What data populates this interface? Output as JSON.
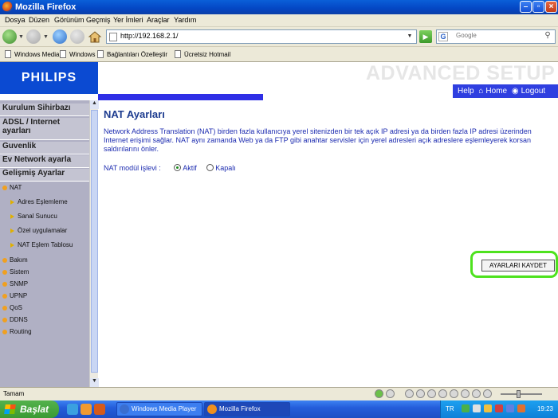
{
  "window": {
    "title": "Mozilla Firefox"
  },
  "menu": [
    "Dosya",
    "Düzen",
    "Görünüm",
    "Geçmiş",
    "Yer İmleri",
    "Araçlar",
    "Yardım"
  ],
  "navbar": {
    "url": "http://192.168.2.1/",
    "search_placeholder": "Google"
  },
  "bookmarks": [
    "Windows Media",
    "Windows",
    "Bağlantıları Özelleştir",
    "Ücretsiz Hotmail"
  ],
  "page": {
    "logo": "PHILIPS",
    "banner": "ADVANCED SETUP",
    "help_links": [
      "Help",
      "Home",
      "Logout"
    ],
    "sidebar": {
      "sections": [
        "Kurulum Sihirbazı",
        "ADSL / Internet ayarları",
        "Guvenlik",
        "Ev Network ayarla",
        "Gelişmiş Ayarlar"
      ],
      "items": [
        "NAT",
        "Adres Eşlemleme",
        "Sanal Sunucu",
        "Özel uygulamalar",
        "NAT Eşlem Tablosu",
        "Bakım",
        "Sistem",
        "SNMP",
        "UPNP",
        "QoS",
        "DDNS",
        "Routing"
      ]
    },
    "heading": "NAT Ayarları",
    "description": "Network Address Translation (NAT) birden fazla kullanıcıya yerel sitenizden bir tek açık IP adresi ya da birden fazla IP adresi üzerinden Internet erişimi sağlar. NAT aynı zamanda Web ya da FTP gibi anahtar servisler için yerel adresleri açık adreslere eşlemleyerek korsan saldırılarını önler.",
    "nat_label": "NAT modül işlevi :",
    "options": [
      "Aktif",
      "Kapalı"
    ],
    "selected_option": "Aktif",
    "save_button": "AYARLARI KAYDET"
  },
  "status": {
    "text": "Tamam"
  },
  "taskbar": {
    "start": "Başlat",
    "tasks": [
      "Windows Media Player",
      "Mozilla Firefox"
    ],
    "lang": "TR",
    "clock": "19:23"
  }
}
